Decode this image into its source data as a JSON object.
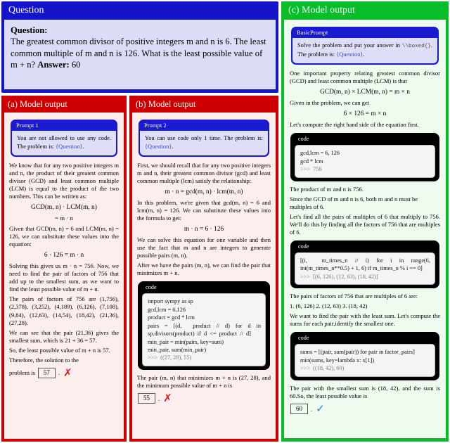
{
  "question_panel": {
    "header": "Question",
    "label": "Question:",
    "body": "The greatest common divisor of positive integers m and n is 6. The least common multiple of m and n is 126. What is the least possible value of m + n?",
    "answer_label": "Answer:",
    "answer_value": "60"
  },
  "panel_a": {
    "header": "(a) Model output",
    "prompt": {
      "title": "Prompt 1",
      "text_1": "You are not allowed to use any code. The problem is: ",
      "token": "{Question}",
      "text_2": "."
    },
    "p1": "We know that for any two positive integers m and n, the product of their greatest common divisor (GCD) and least common multiple (LCM) is equal to the product of the two numbers. This can be written as:",
    "eq1a": "GCD(m, n) · LCM(m, n)",
    "eq1b": "= m · n",
    "p2": "Given that GCD(m, n) = 6 and LCM(m, n) = 126, we can substitute these values into the equation:",
    "eq2": "6 · 126 = m · n",
    "p3": "Solving this gives us m · n = 756. Now, we need to find the pair of factors of 756 that add up to the smallest sum, as we want to find the least possible value of m + n.",
    "p4": "The pairs of factors of 756 are (1,756), (2,378), (3,252), (4,189), (6,126), (7,108), (9,84), (12,63), (14,54), (18,42), (21,36), (27,28).",
    "p5": "We can see that the pair (21,36) gives the smallest sum, which is 21 + 36 = 57.",
    "p6": "So, the least possible value of m + n is 57.",
    "p7": "Therefore, the solution to the",
    "answer_prefix": "problem is",
    "answer_value": "57",
    "answer_suffix": ".",
    "verdict": "✗"
  },
  "panel_b": {
    "header": "(b) Model output",
    "prompt": {
      "title": "Prompt 2",
      "text_1": "You can use code only 1 time. The problem is: ",
      "token": "{Question}",
      "text_2": "."
    },
    "p1": "First, we should recall that for any two positive integers m and n, their greatest common divisor (gcd) and least common multiple (lcm) satisfy the relationship:",
    "eq1": "m · n = gcd(m, n) · lcm(m, n)",
    "p2": "In this problem, we're given that gcd(m, n) = 6 and lcm(m, n) = 126. We can substitute these values into the formula to get:",
    "eq2": "m · n = 6 · 126",
    "p3": "We can solve this equation for one variable and then use the fact that m and n are integers to generate possible pairs (m, n).",
    "p4": "After we have the pairs (m, n), we can find the pair that minimizes m + n.",
    "code": {
      "title": "code",
      "lines": [
        "import sympy as sp",
        "gcd,lcm = 6,126",
        "product = gcd * lcm",
        "pairs  =  [(d,    product  //  d)  for  d  in  sp.divisors(product)  if  d  <=  product  //  d]",
        "min_pair = min(pairs, key=sum)",
        "min_pair, sum(min_pair)"
      ],
      "output": ">>>  ((27, 28), 55)"
    },
    "p5_part1": "The pair (m, n) that minimizes m + n is (27, 28), and the minimum possible value of m + n is",
    "answer_value": "55",
    "answer_suffix": ".",
    "verdict": "✗"
  },
  "panel_c": {
    "header": "(c) Model output",
    "prompt": {
      "title": "BasicPrompt",
      "text_1": "Solve the problem and put your answer in ",
      "mono": "\\\\boxed{}",
      "text_2": ". The problem is: ",
      "token": "{Question}",
      "text_3": "."
    },
    "p1": "One important property relating greatest common divisor (GCD) and least common multiple (LCM) is that",
    "eq1": "GCD(m, n) × LCM(m, n) = m × n",
    "p2": "Given in the problem, we can get",
    "eq2": "6 × 126 = m × n",
    "p3": "Let's compute the right hand side of the equation first.",
    "code1": {
      "title": "code",
      "lines": [
        "gcd,lcm = 6, 126",
        "gcd * lcm"
      ],
      "output": ">>>  756"
    },
    "p4": "The product of m and n is 756.",
    "p5": "Since the GCD of m and n is 6, both m and n must be multiples of 6.",
    "p6": "Let's find all the pairs of multiples of 6 that multiply to 756. We'll do this by finding all the factors of 756 that are multiples of 6.",
    "code2": {
      "title": "code",
      "lines": [
        "[(i,    m_times_n  //  i)  for  i  in  range(6, int(m_times_n**0.5) + 1, 6) if m_times_n % i == 0]"
      ],
      "output": ">>>  [(6, 126), (12, 63), (18, 42)]"
    },
    "p7": "The pairs of factors of 756 that are multiples of 6 are:",
    "p8": "1. (6, 126) 2. (12, 63) 3. (18, 42)",
    "p9": "We want to find the pair with the least sum. Let's compute the sums for each pair,identify the smallest one.",
    "code3": {
      "title": "code",
      "lines": [
        "sums = [(pair, sum(pair)) for pair in factor_pairs]",
        "min(sums, key=lambda x: x[1])"
      ],
      "output": ">>>  ((18, 42), 60)"
    },
    "p10_part1": "The pair with the smallest sum is (18, 42), and the sum is 60.So, the least possible value is",
    "answer_value": "60",
    "answer_suffix": ".",
    "verdict": "✓"
  },
  "colors": {
    "question_blue": "#1414c8",
    "panel_red": "#cc0000",
    "panel_green": "#07bd28",
    "prompt_blue": "#1a1ad0",
    "code_black": "#000000",
    "wrong_red": "#e8131b",
    "correct_blue": "#1a7fd4"
  }
}
